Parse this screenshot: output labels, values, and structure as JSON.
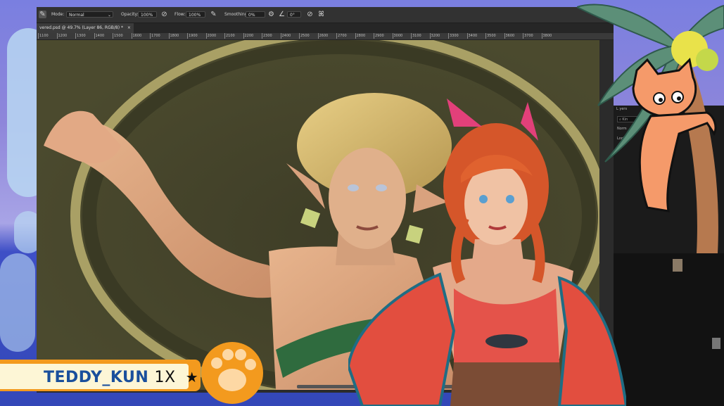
{
  "options_bar": {
    "mode_label": "Mode:",
    "mode_value": "Normal",
    "opacity_label": "Opacity:",
    "opacity_value": "100%",
    "flow_label": "Flow:",
    "flow_value": "100%",
    "smoothing_label": "Smoothing:",
    "smoothing_value": "0%",
    "angle_value": "0°",
    "icons": [
      "brush-preset-icon",
      "pressure-opacity-icon",
      "airbrush-icon",
      "smoothing-gear-icon",
      "angle-icon",
      "pressure-size-icon",
      "symmetry-butterfly-icon"
    ]
  },
  "document": {
    "tab_label": "vered.psd @ 49.7% (Layer 86, RGB/8) *",
    "tab_close": "×",
    "ruler_ticks": [
      "1100",
      "1200",
      "1300",
      "1400",
      "1500",
      "1600",
      "1700",
      "1800",
      "1900",
      "2000",
      "2100",
      "2200",
      "2300",
      "2400",
      "2500",
      "2600",
      "2700",
      "2800",
      "2900",
      "3000",
      "3100",
      "3200",
      "3300",
      "3400",
      "3500",
      "3600",
      "3700",
      "3800"
    ]
  },
  "layers_panel": {
    "header": "L yers",
    "search_placeholder": "Kin",
    "blend": "Norm",
    "lock_label": "Lock:"
  },
  "overlay": {
    "username": "TEDDY_KUN",
    "multiplier": "1X",
    "star": "★",
    "colors": {
      "banner_orange": "#f39a1e",
      "banner_cream": "#fdf6d6",
      "username_blue": "#1a4f9c",
      "canvas_bg": "#424228"
    }
  }
}
